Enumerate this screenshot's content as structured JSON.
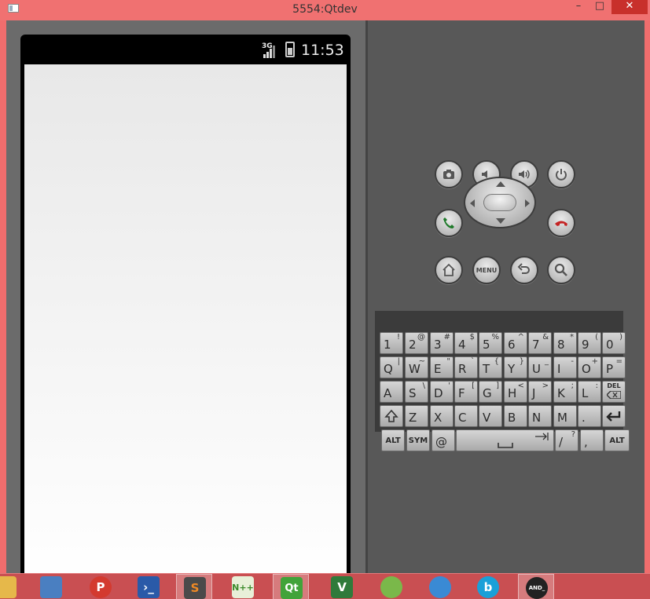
{
  "window": {
    "title": "5554:Qtdev",
    "minimize": "–",
    "maximize": "□",
    "close": "✕"
  },
  "statusbar": {
    "network": "3G",
    "time": "11:53"
  },
  "hardware": {
    "menu_label": "MENU"
  },
  "keyboard": {
    "rows": [
      [
        {
          "m": "1",
          "a": "!"
        },
        {
          "m": "2",
          "a": "@"
        },
        {
          "m": "3",
          "a": "#"
        },
        {
          "m": "4",
          "a": "$"
        },
        {
          "m": "5",
          "a": "%"
        },
        {
          "m": "6",
          "a": "^"
        },
        {
          "m": "7",
          "a": "&"
        },
        {
          "m": "8",
          "a": "*"
        },
        {
          "m": "9",
          "a": "("
        },
        {
          "m": "0",
          "a": ")"
        }
      ],
      [
        {
          "m": "Q",
          "a": "|"
        },
        {
          "m": "W",
          "a": "~"
        },
        {
          "m": "E",
          "a": "\""
        },
        {
          "m": "R",
          "a": "`"
        },
        {
          "m": "T",
          "a": "{"
        },
        {
          "m": "Y",
          "a": "}"
        },
        {
          "m": "U",
          "a": "_"
        },
        {
          "m": "I",
          "a": "-"
        },
        {
          "m": "O",
          "a": "+"
        },
        {
          "m": "P",
          "a": "="
        }
      ],
      [
        {
          "m": "A",
          "a": ""
        },
        {
          "m": "S",
          "a": "\\"
        },
        {
          "m": "D",
          "a": "'"
        },
        {
          "m": "F",
          "a": "["
        },
        {
          "m": "G",
          "a": "]"
        },
        {
          "m": "H",
          "a": "<"
        },
        {
          "m": "J",
          "a": ">"
        },
        {
          "m": "K",
          "a": ";"
        },
        {
          "m": "L",
          "a": ":"
        }
      ],
      [
        {
          "m": "Z",
          "a": ""
        },
        {
          "m": "X",
          "a": ""
        },
        {
          "m": "C",
          "a": ""
        },
        {
          "m": "V",
          "a": ""
        },
        {
          "m": "B",
          "a": ""
        },
        {
          "m": "N",
          "a": ""
        },
        {
          "m": "M",
          "a": ""
        },
        {
          "m": ".",
          "a": ""
        }
      ]
    ],
    "del_label": "DEL",
    "alt_label": "ALT",
    "sym_label": "SYM",
    "at_label": "@",
    "slash": {
      "m": "/",
      "a": "?"
    },
    "comma": {
      "m": ",",
      "a": ""
    }
  },
  "taskbar": {
    "items": [
      "file-explorer",
      "virtualbox",
      "psiphon",
      "powershell",
      "sublime-text",
      "notepad-plus-plus",
      "qt-creator",
      "visual-studio",
      "android-studio",
      "network-globe",
      "bing",
      "android-emulator"
    ],
    "labels": {
      "psiphon": "P",
      "qt": "Qt",
      "vs": "V",
      "bing": "b",
      "and": "AND_"
    }
  }
}
